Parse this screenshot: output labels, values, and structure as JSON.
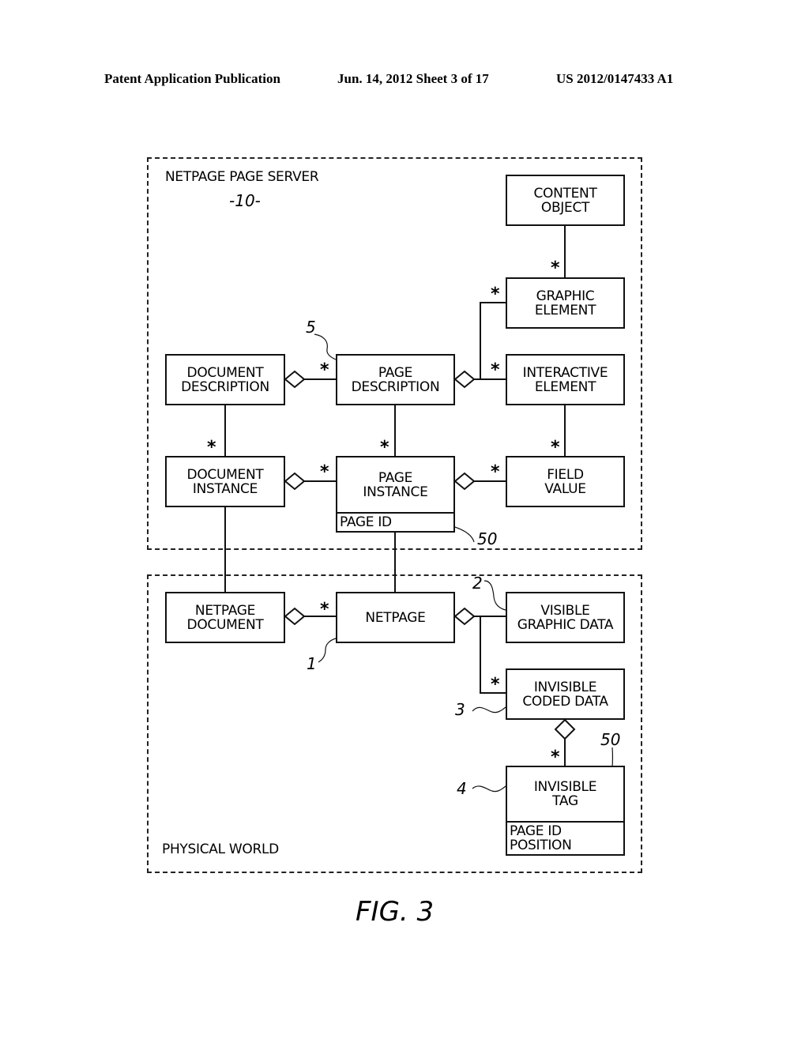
{
  "header": {
    "publication": "Patent Application Publication",
    "date_sheet": "Jun. 14, 2012  Sheet 3 of 17",
    "number": "US 2012/0147433 A1"
  },
  "regions": {
    "server": {
      "label": "NETPAGE PAGE SERVER",
      "ref": "-10-"
    },
    "physical": {
      "label": "PHYSICAL WORLD"
    }
  },
  "classes": {
    "content_object": {
      "name": "CONTENT\nOBJECT"
    },
    "graphic_element": {
      "name": "GRAPHIC\nELEMENT"
    },
    "interactive_element": {
      "name": "INTERACTIVE\nELEMENT"
    },
    "document_description": {
      "name": "DOCUMENT\nDESCRIPTION"
    },
    "page_description": {
      "name": "PAGE\nDESCRIPTION"
    },
    "document_instance": {
      "name": "DOCUMENT\nINSTANCE"
    },
    "page_instance": {
      "name": "PAGE\nINSTANCE",
      "attrs": "PAGE ID"
    },
    "field_value": {
      "name": "FIELD\nVALUE"
    },
    "netpage_document": {
      "name": "NETPAGE\nDOCUMENT"
    },
    "netpage": {
      "name": "NETPAGE"
    },
    "visible_graphic_data": {
      "name": "VISIBLE\nGRAPHIC DATA"
    },
    "invisible_coded_data": {
      "name": "INVISIBLE\nCODED DATA"
    },
    "invisible_tag": {
      "name": "INVISIBLE\nTAG",
      "attrs": "PAGE ID\nPOSITION"
    }
  },
  "multiplicity": "*",
  "refs": {
    "page_description": "5",
    "page_id_server": "50",
    "netpage": "1",
    "visible_graphic_data": "2",
    "invisible_coded_data": "3",
    "invisible_tag": "4",
    "page_id_tag": "50"
  },
  "figure_label": "FIG. 3"
}
